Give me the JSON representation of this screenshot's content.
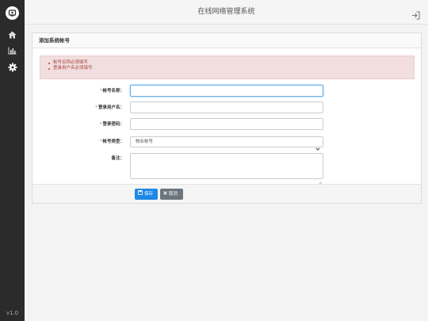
{
  "app": {
    "title": "在线网络管理系统",
    "version": "v1.0"
  },
  "sidebar": {
    "icons": [
      "logo-icon",
      "home-icon",
      "bar-chart-icon",
      "gear-icon"
    ]
  },
  "topbar": {
    "logout_icon": "logout-icon"
  },
  "panel": {
    "title": "添加系统帐号"
  },
  "alert": {
    "messages": [
      "帐号名称必须填写",
      "登录用户名必须填写"
    ],
    "colors": {
      "background": "#f2dede",
      "text": "#a94442"
    }
  },
  "form": {
    "account_name": {
      "label": "帐号名称：",
      "required_mark": "*",
      "value": ""
    },
    "username": {
      "label": "登录用户名：",
      "required_mark": "*",
      "value": ""
    },
    "password": {
      "label": "登录密码：",
      "required_mark": "*",
      "value": ""
    },
    "account_type": {
      "label": "帐号类型：",
      "required_mark": "*",
      "selected": "物业帐号"
    },
    "remark": {
      "label": "备注：",
      "value": ""
    }
  },
  "buttons": {
    "save": {
      "label": "保存",
      "icon": "save-icon",
      "color": "#1e88e5"
    },
    "cancel": {
      "label": "取消",
      "icon": "close-icon",
      "color": "#6c757d"
    }
  }
}
